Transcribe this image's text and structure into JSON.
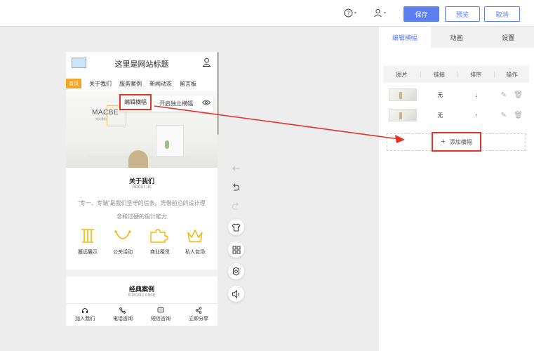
{
  "topbar": {
    "save_label": "保存",
    "preview_label": "预览",
    "cancel_label": "取消"
  },
  "right_panel": {
    "tabs": [
      {
        "label": "编辑横幅",
        "active": true
      },
      {
        "label": "动画",
        "active": false
      },
      {
        "label": "设置",
        "active": false
      }
    ],
    "table": {
      "headers": [
        "图片",
        "链接",
        "排序",
        "操作"
      ],
      "rows": [
        {
          "link": "无",
          "sort": "↓"
        },
        {
          "link": "无",
          "sort": "↑"
        }
      ]
    },
    "add_banner_label": "添加横幅"
  },
  "phone": {
    "site_title": "这里是网站标题",
    "nav_home": "首页",
    "nav_items": [
      "关于我们",
      "服务案例",
      "新闻动态",
      "留言板"
    ],
    "banner_text": "MACBE",
    "banner_sub": "独具慧眼",
    "edit_banner_label": "编辑横幅",
    "independent_banner_label": "开启独立横幅",
    "about": {
      "title": "关于我们",
      "subtitle": "About us",
      "text_line1": "“专一、专端”是我们坚守的信条。凭借前沿的设计理",
      "text_line2": "念和过硬的设计能力"
    },
    "features": [
      "履远展示",
      "公关活动",
      "商业租赁",
      "私人包场"
    ],
    "cases": {
      "title": "经典案例",
      "subtitle": "Classic case"
    },
    "footer": [
      "加入我们",
      "电话咨询",
      "短信咨询",
      "立即分享"
    ]
  },
  "colors": {
    "accent": "#5b7ff0",
    "highlight_red": "#e33226",
    "feature_gold": "#f5b400"
  }
}
